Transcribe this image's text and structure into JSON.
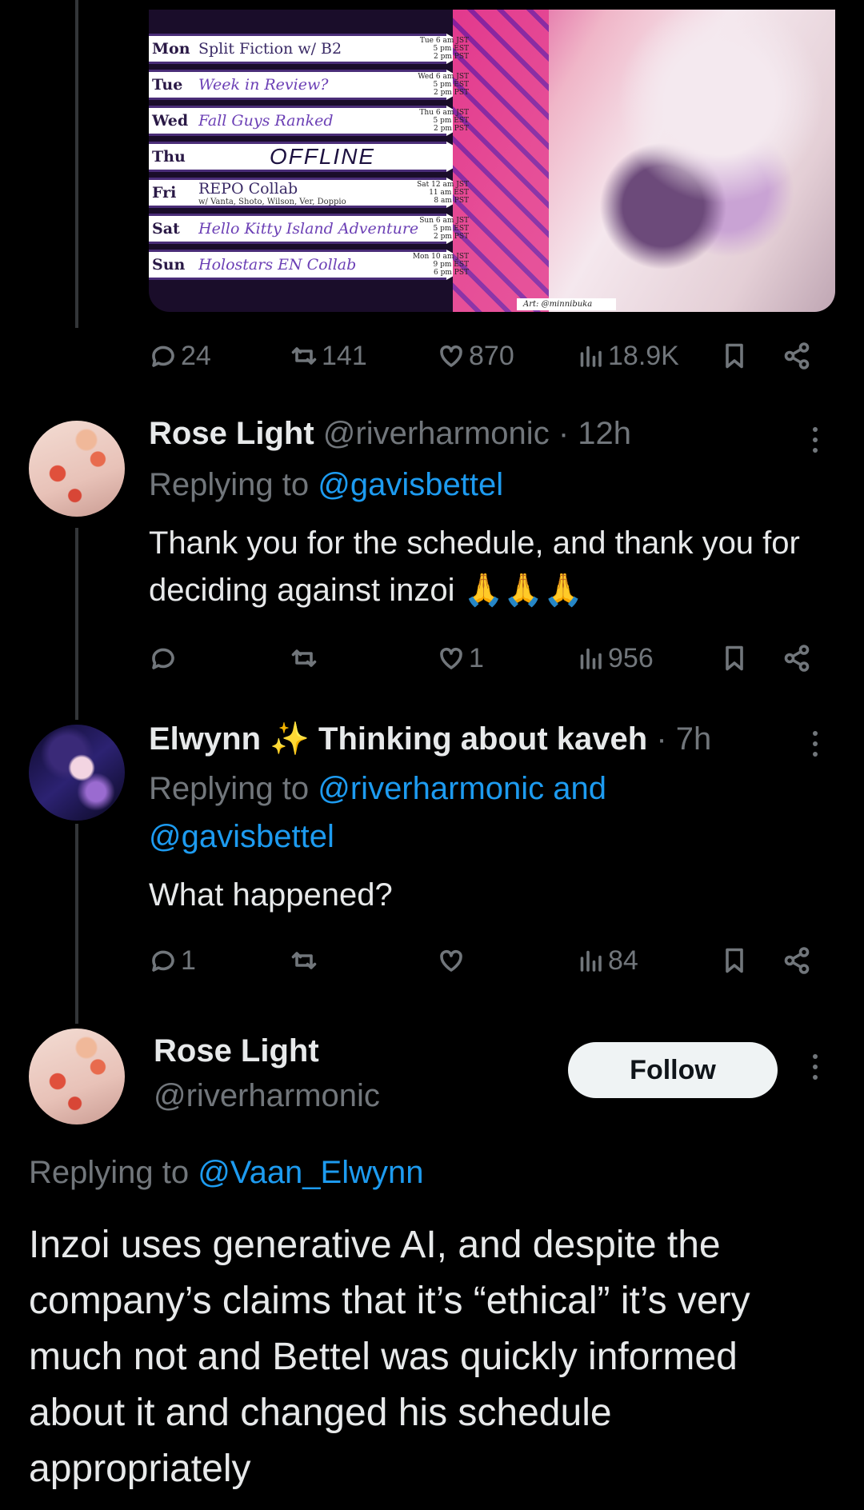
{
  "schedule": {
    "rows": [
      {
        "day": "Mon",
        "title": "Split Fiction w/ B2",
        "sub": "",
        "times": [
          "Tue 6 am JST",
          "5 pm EST",
          "2 pm PST"
        ],
        "style": "plain"
      },
      {
        "day": "Tue",
        "title": "Week in Review?",
        "sub": "",
        "times": [
          "Wed 6 am JST",
          "5 pm EST",
          "2 pm PST"
        ],
        "style": "cursive"
      },
      {
        "day": "Wed",
        "title": "Fall Guys Ranked",
        "sub": "",
        "times": [
          "Thu 6 am JST",
          "5 pm EST",
          "2 pm PST"
        ],
        "style": "cursive"
      },
      {
        "day": "Thu",
        "title": "OFFLINE",
        "sub": "",
        "times": [],
        "style": "offline"
      },
      {
        "day": "Fri",
        "title": "REPO Collab",
        "sub": "w/ Vanta, Shoto, Wilson, Ver, Doppio",
        "times": [
          "Sat 12 am JST",
          "11 am EST",
          "8 am PST"
        ],
        "style": "plain"
      },
      {
        "day": "Sat",
        "title": "Hello Kitty Island Adventure",
        "sub": "",
        "times": [
          "Sun 6 am JST",
          "5 pm EST",
          "2 pm PST"
        ],
        "style": "cursive"
      },
      {
        "day": "Sun",
        "title": "Holostars EN Collab",
        "sub": "",
        "times": [
          "Mon 10 am JST",
          "9 pm EST",
          "6 pm PST"
        ],
        "style": "cursive"
      }
    ],
    "art_credit": "Art: @minnibuka"
  },
  "main_post_actions": {
    "replies": "24",
    "reposts": "141",
    "likes": "870",
    "views": "18.9K"
  },
  "reply1": {
    "name": "Rose Light",
    "handle": "@riverharmonic",
    "time": "· 12h",
    "replying_prefix": "Replying to",
    "replying_to": "@gavisbettel",
    "text": "Thank you for the schedule, and thank you for deciding against inzoi 🙏🙏🙏",
    "actions": {
      "replies": "",
      "reposts": "",
      "likes": "1",
      "views": "956"
    }
  },
  "reply2": {
    "name": "Elwynn ✨ Thinking about kaveh",
    "time": "· 7h",
    "replying_prefix": "Replying to",
    "replying_to_1": "@riverharmonic and",
    "replying_to_2": "@gavisbettel",
    "text": "What happened?",
    "actions": {
      "replies": "1",
      "reposts": "",
      "likes": "",
      "views": "84"
    }
  },
  "focused": {
    "name": "Rose Light",
    "handle": "@riverharmonic",
    "follow_label": "Follow",
    "replying_prefix": "Replying to",
    "replying_to": "@Vaan_Elwynn",
    "text": "Inzoi uses generative AI, and despite the company’s claims that it’s “ethical” it’s very much not and Bettel was quickly informed about it and changed his schedule appropriately"
  },
  "icons": [
    "reply-icon",
    "repost-icon",
    "like-icon",
    "views-icon",
    "bookmark-icon",
    "share-icon",
    "more-icon"
  ],
  "colors": {
    "background": "#000000",
    "text": "#e7e9ea",
    "muted": "#71767b",
    "link": "#1d9bf0",
    "thread_line": "#333639"
  }
}
